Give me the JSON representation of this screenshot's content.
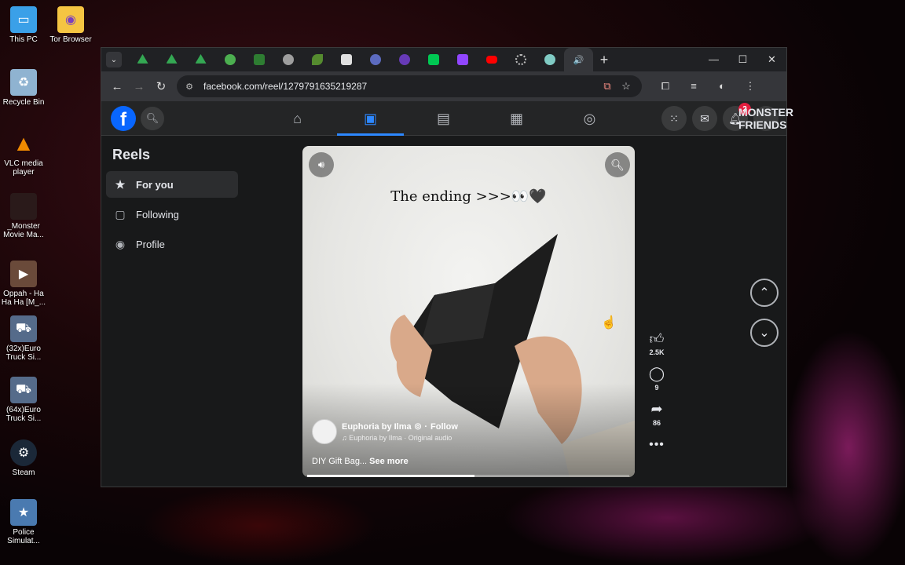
{
  "desktop": {
    "icons": [
      {
        "label": "This PC",
        "icon": "monitor-icon",
        "color": "#3aa0e8"
      },
      {
        "label": "Tor Browser",
        "icon": "tor-folder-icon",
        "color": "#f5c542"
      },
      {
        "label": "Recycle Bin",
        "icon": "recycle-bin-icon",
        "color": "#8fb3d1"
      },
      {
        "label": "VLC media player",
        "icon": "vlc-icon",
        "color": "#f08a00"
      },
      {
        "label": "_Monster Movie Ma...",
        "icon": "monster-icon",
        "color": "#2a1a1a"
      },
      {
        "label": "Oppah - Ha Ha Ha [M_...",
        "icon": "video-icon",
        "color": "#6a4a3a"
      },
      {
        "label": "(32x)Euro Truck Si...",
        "icon": "truck-icon",
        "color": "#556b8a"
      },
      {
        "label": "(64x)Euro Truck Si...",
        "icon": "truck-icon",
        "color": "#556b8a"
      },
      {
        "label": "Steam",
        "icon": "steam-icon",
        "color": "#1b2838"
      },
      {
        "label": "Police Simulat...",
        "icon": "police-icon",
        "color": "#4a7ab0"
      }
    ]
  },
  "browser": {
    "tab_favicons": [
      {
        "icon": "drive-icon",
        "color": "#34a853"
      },
      {
        "icon": "drive-icon",
        "color": "#34a853"
      },
      {
        "icon": "drive-icon",
        "color": "#34a853"
      },
      {
        "icon": "green-circle-icon",
        "color": "#4caf50"
      },
      {
        "icon": "st-icon",
        "color": "#2e7d32"
      },
      {
        "icon": "globe-icon",
        "color": "#9e9e9e"
      },
      {
        "icon": "leaf-icon",
        "color": "#558b2f"
      },
      {
        "icon": "image-icon",
        "color": "#e0e0e0"
      },
      {
        "icon": "app-icon",
        "color": "#5c6bc0"
      },
      {
        "icon": "app-icon",
        "color": "#673ab7"
      },
      {
        "icon": "k-icon",
        "color": "#00c853"
      },
      {
        "icon": "twitch-icon",
        "color": "#9146ff"
      },
      {
        "icon": "youtube-icon",
        "color": "#ff0000"
      },
      {
        "icon": "gear-icon",
        "color": "#bdbdbd"
      },
      {
        "icon": "search-globe-icon",
        "color": "#80cbc4"
      },
      {
        "icon": "speaker-icon",
        "color": "#dddddd"
      }
    ],
    "new_tab": "+",
    "url": "facebook.com/reel/1279791635219287"
  },
  "facebook": {
    "logo": "f",
    "notifications_count": "2",
    "avatar_text": "MONSTER FRIENDS",
    "sidebar": {
      "title": "Reels",
      "items": [
        {
          "label": "For you",
          "icon": "star-icon"
        },
        {
          "label": "Following",
          "icon": "following-icon"
        },
        {
          "label": "Profile",
          "icon": "profile-icon"
        }
      ]
    },
    "reel": {
      "caption_top": "The ending >>>👀🖤",
      "author": "Euphoria by Ilma",
      "follow": "Follow",
      "audio": "♫ Euphoria by Ilma · Original audio",
      "description": "DIY Gift Bag...",
      "see_more": "See more",
      "progress": 0.52,
      "likes": "2.5K",
      "comments": "9",
      "shares": "86"
    }
  }
}
